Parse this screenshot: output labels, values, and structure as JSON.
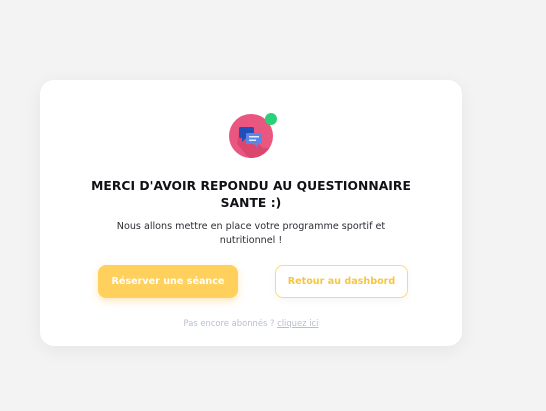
{
  "dialog": {
    "title_line1": "MERCI D'AVOIR REPONDU AU QUESTIONNAIRE",
    "title_line2": "SANTE :)",
    "message_line1": "Nous allons mettre en place votre programme sportif et",
    "message_line2": "nutritionnel !",
    "primary_button_label": "Réserver une séance",
    "secondary_button_label": "Retour au dashbord",
    "footer_text": "Pas encore abonnés ?",
    "footer_link_label": "cliquez ici"
  },
  "icons": {
    "avatar": "chat-bubbles-icon",
    "status": "online-status-icon"
  },
  "colors": {
    "background": "#f3f3f4",
    "card": "#ffffff",
    "accent_yellow": "#ffd05b",
    "avatar_pink": "#e9567f",
    "status_green": "#2bd07a",
    "footer_gray": "#b7bfcf"
  }
}
